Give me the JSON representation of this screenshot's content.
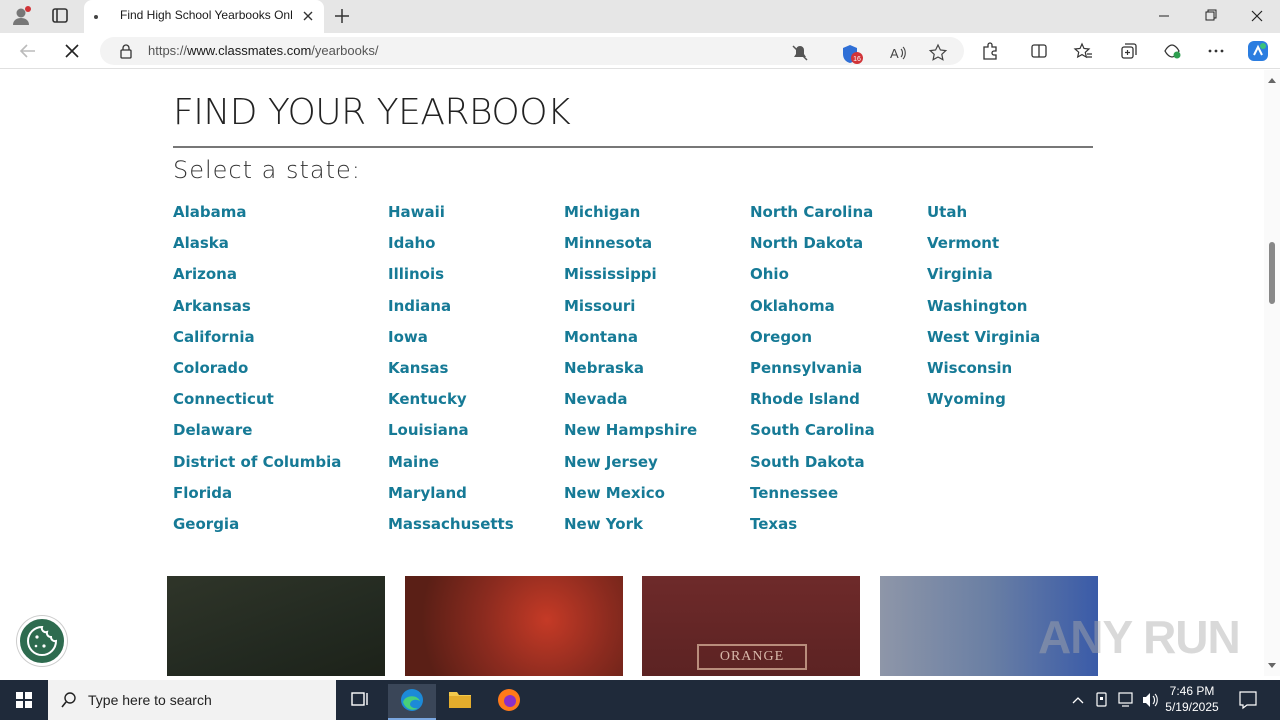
{
  "browser": {
    "tab_title": "Find High School Yearbooks Onli",
    "url_host_prefix": "https://",
    "url_host": "www.classmates.com",
    "url_path": "/yearbooks/",
    "extension_badge": "16"
  },
  "page": {
    "heading": "FIND YOUR YEARBOOK",
    "subheading": "Select a state:",
    "link_color": "#167a96",
    "columns": [
      [
        "Alabama",
        "Alaska",
        "Arizona",
        "Arkansas",
        "California",
        "Colorado",
        "Connecticut",
        "Delaware",
        "District of Columbia",
        "Florida",
        "Georgia"
      ],
      [
        "Hawaii",
        "Idaho",
        "Illinois",
        "Indiana",
        "Iowa",
        "Kansas",
        "Kentucky",
        "Louisiana",
        "Maine",
        "Maryland",
        "Massachusetts"
      ],
      [
        "Michigan",
        "Minnesota",
        "Mississippi",
        "Missouri",
        "Montana",
        "Nebraska",
        "Nevada",
        "New Hampshire",
        "New Jersey",
        "New Mexico",
        "New York"
      ],
      [
        "North Carolina",
        "North Dakota",
        "Ohio",
        "Oklahoma",
        "Oregon",
        "Pennsylvania",
        "Rhode Island",
        "South Carolina",
        "South Dakota",
        "Tennessee",
        "Texas"
      ],
      [
        "Utah",
        "Vermont",
        "Virginia",
        "Washington",
        "West Virginia",
        "Wisconsin",
        "Wyoming"
      ]
    ],
    "yearbook_cover_text": "ORANGE",
    "watermark": "ANY RUN"
  },
  "taskbar": {
    "search_placeholder": "Type here to search",
    "time": "7:46 PM",
    "date": "5/19/2025"
  }
}
